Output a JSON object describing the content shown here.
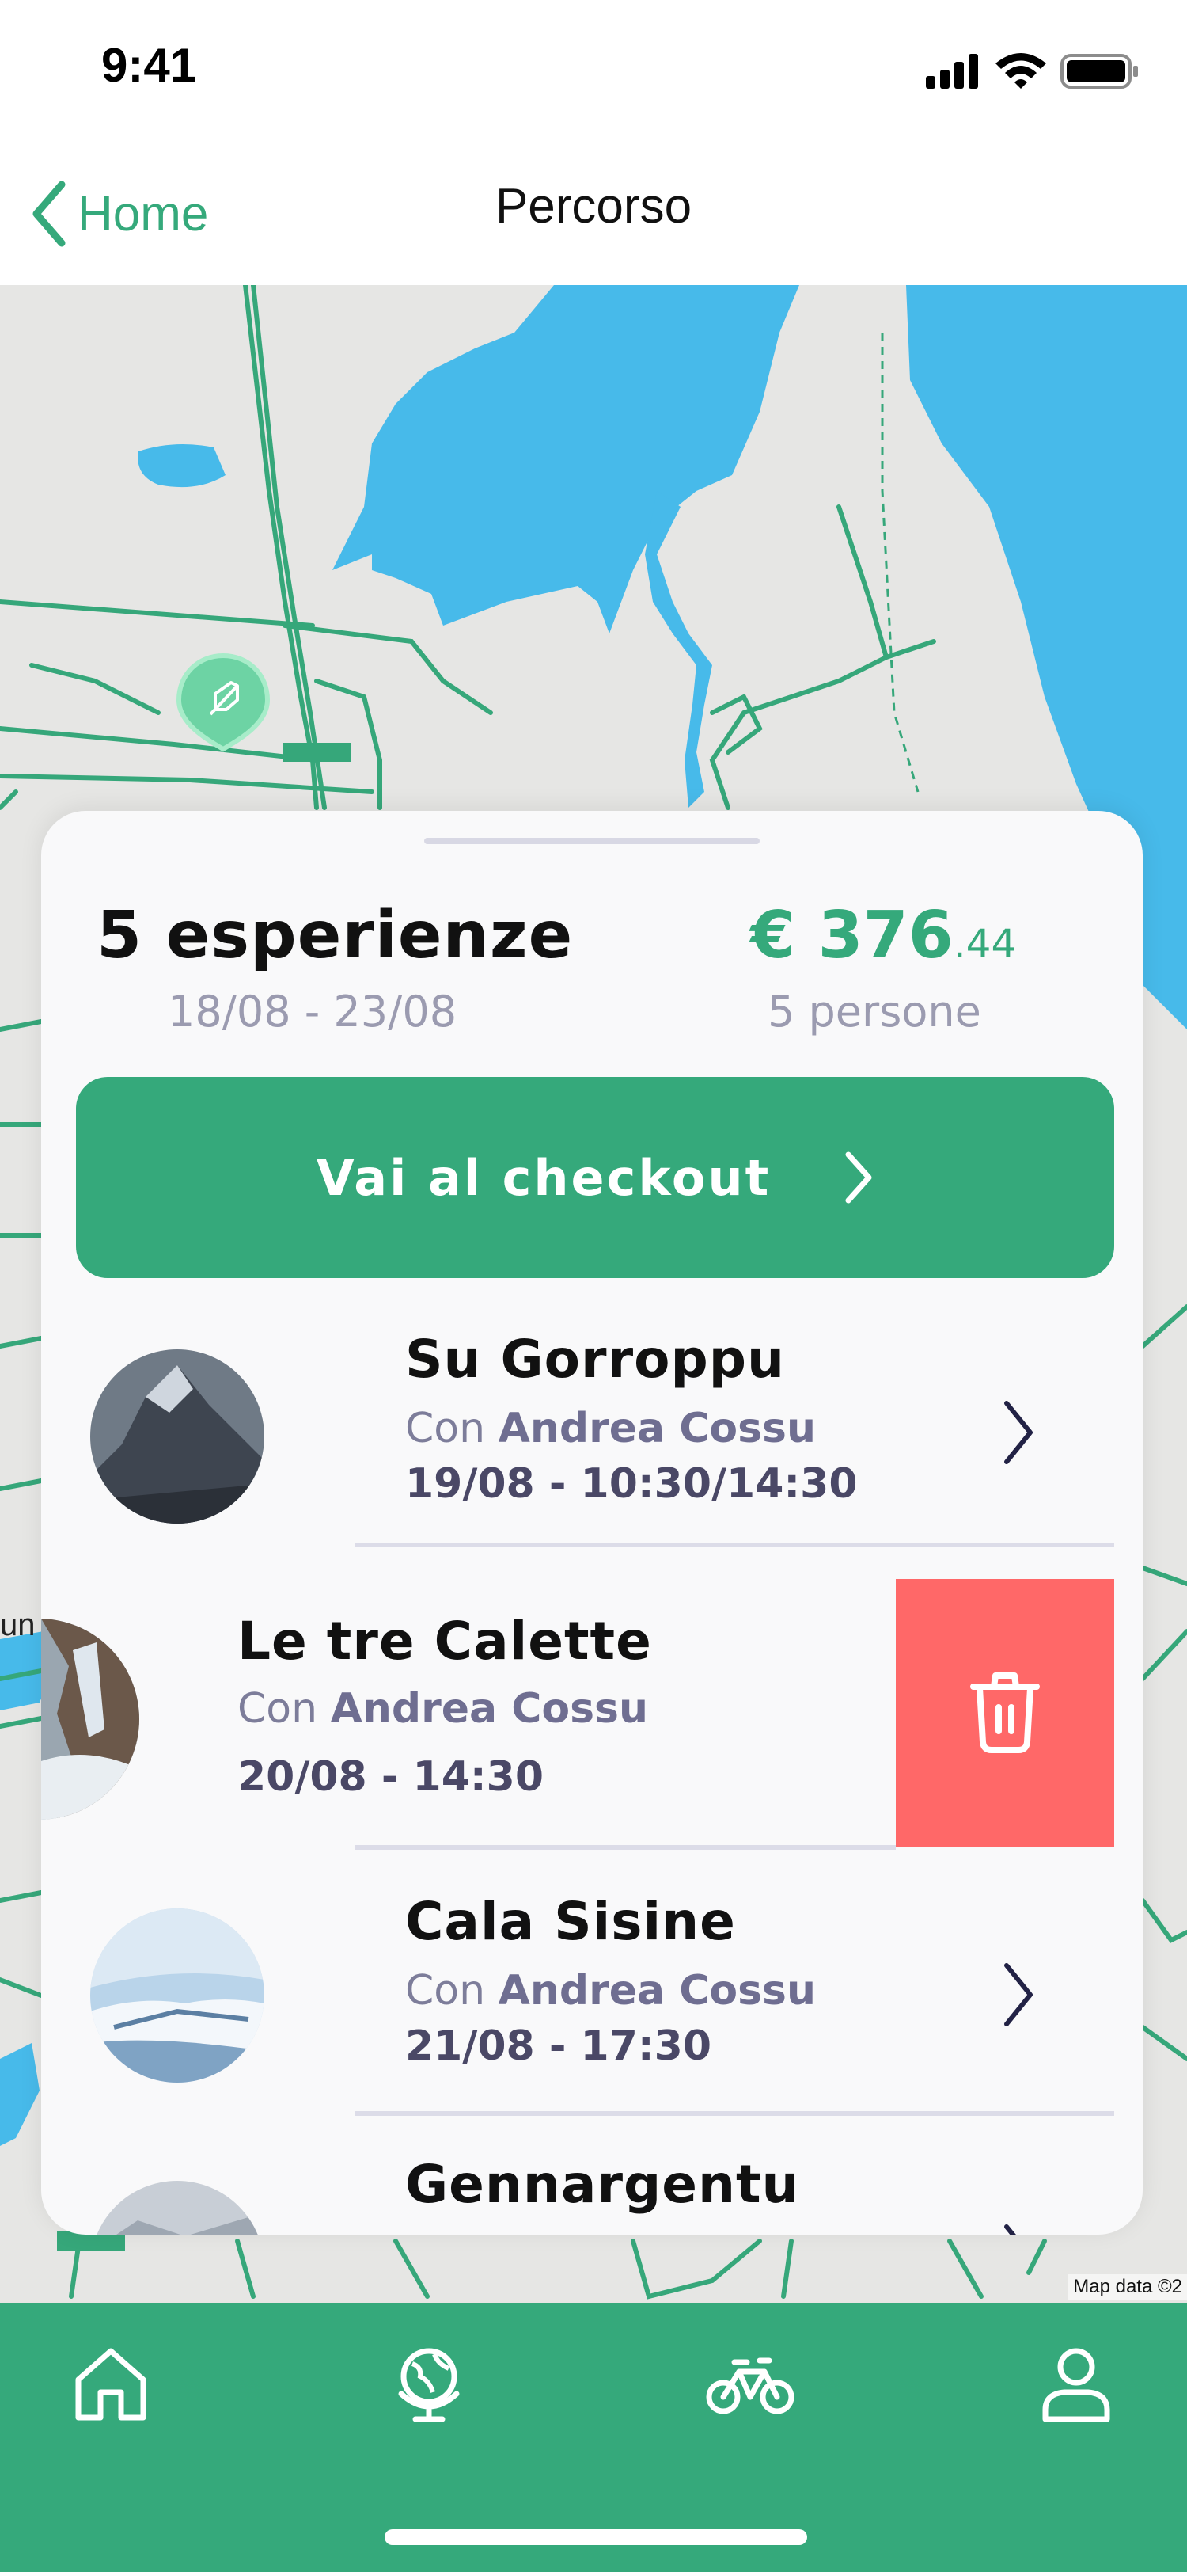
{
  "status_bar": {
    "time": "9:41"
  },
  "nav": {
    "back_label": "Home",
    "title": "Percorso"
  },
  "map": {
    "credit": "Map data ©2",
    "place_label": "un"
  },
  "summary": {
    "experiences": "5 esperienze",
    "dates": "18/08 - 23/08",
    "price_main": "€ 376",
    "price_decimals": ".44",
    "people": "5 persone"
  },
  "checkout": {
    "label": "Vai al checkout"
  },
  "experiences": [
    {
      "title": "Su Gorroppu",
      "guide_prefix": "Con",
      "guide": "Andrea Cossu",
      "time": "19/08 - 10:30/14:30"
    },
    {
      "title": "Le tre Calette",
      "guide_prefix": "Con",
      "guide": "Andrea Cossu",
      "time": "20/08 - 14:30"
    },
    {
      "title": "Cala Sisine",
      "guide_prefix": "Con",
      "guide": "Andrea Cossu",
      "time": "21/08 - 17:30"
    },
    {
      "title": "Gennargentu"
    }
  ],
  "icons": {
    "back": "chevron-left-icon",
    "checkout": "chevron-right-icon",
    "delete": "trash-icon",
    "tabs": [
      "home-icon",
      "globe-icon",
      "bicycle-icon",
      "user-icon"
    ]
  },
  "colors": {
    "accent": "#35a97b",
    "delete": "#ff6868",
    "water": "#47baea",
    "map_bg": "#e6e6e4"
  }
}
